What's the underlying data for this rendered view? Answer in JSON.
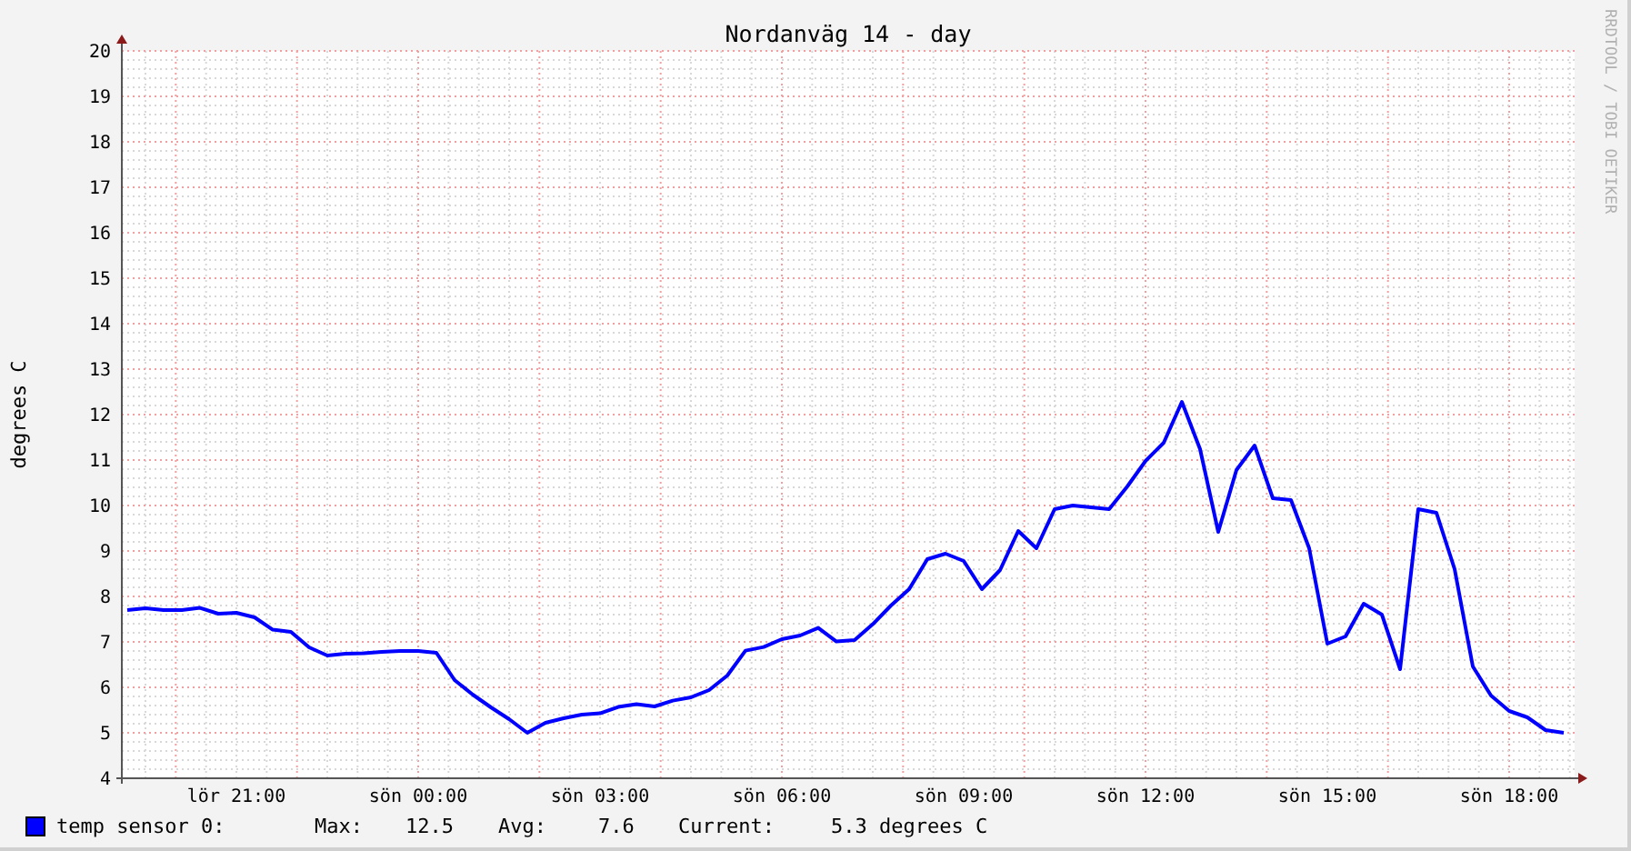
{
  "chart_data": {
    "type": "line",
    "grid": true,
    "title": "Nordanväg 14 - day",
    "ylabel": "degrees C",
    "ylim": [
      4,
      20
    ],
    "categories": [
      null,
      null,
      null,
      null,
      null,
      null,
      "lör 21:00",
      null,
      null,
      null,
      null,
      null,
      null,
      null,
      null,
      null,
      "sön 00:00",
      null,
      null,
      null,
      null,
      null,
      null,
      null,
      null,
      null,
      "sön 03:00",
      null,
      null,
      null,
      null,
      null,
      null,
      null,
      null,
      null,
      "sön 06:00",
      null,
      null,
      null,
      null,
      null,
      null,
      null,
      null,
      null,
      "sön 09:00",
      null,
      null,
      null,
      null,
      null,
      null,
      null,
      null,
      null,
      "sön 12:00",
      null,
      null,
      null,
      null,
      null,
      null,
      null,
      null,
      null,
      "sön 15:00",
      null,
      null,
      null,
      null,
      null,
      null,
      null,
      null,
      null,
      "sön 18:00",
      null,
      null,
      null
    ],
    "series": [
      {
        "color": "#0000ff",
        "values": [
          7.7,
          7.74,
          7.7,
          7.7,
          7.75,
          7.62,
          7.64,
          7.54,
          7.27,
          7.22,
          6.88,
          6.7,
          6.74,
          6.75,
          6.78,
          6.8,
          6.8,
          6.76,
          6.16,
          5.84,
          5.56,
          5.3,
          5.0,
          5.22,
          5.32,
          5.4,
          5.43,
          5.57,
          5.63,
          5.58,
          5.71,
          5.78,
          5.94,
          6.26,
          6.81,
          6.89,
          7.06,
          7.14,
          7.31,
          7.01,
          7.04,
          7.39,
          7.8,
          8.16,
          8.82,
          8.94,
          8.78,
          8.16,
          8.58,
          9.44,
          9.06,
          9.92,
          10.0,
          9.96,
          9.92,
          10.42,
          10.98,
          11.38,
          12.28,
          11.24,
          9.42,
          10.78,
          11.32,
          10.16,
          10.12,
          9.06,
          6.96,
          7.12,
          7.84,
          7.6,
          6.4,
          9.92,
          9.84,
          8.6,
          6.46,
          5.82,
          5.48,
          5.34,
          5.06,
          5.0
        ]
      }
    ],
    "yticks": [
      4,
      5,
      6,
      7,
      8,
      9,
      10,
      11,
      12,
      13,
      14,
      15,
      16,
      17,
      18,
      19,
      20
    ]
  },
  "credit": "RRDTOOL / TOBI OETIKER",
  "legend": {
    "label": "temp sensor 0:",
    "color": "#0000ff",
    "stats": [
      {
        "label": "Max:",
        "value": "12.5"
      },
      {
        "label": "Avg:",
        "value": "7.6"
      },
      {
        "label": "Current:",
        "value": "5.3 degrees C"
      }
    ]
  }
}
